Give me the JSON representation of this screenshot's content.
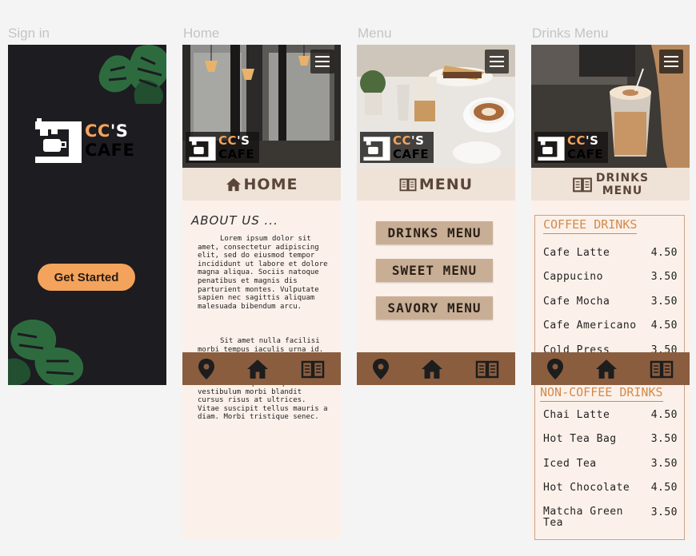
{
  "frames": [
    {
      "label": "Sign in"
    },
    {
      "label": "Home"
    },
    {
      "label": "Menu"
    },
    {
      "label": "Drinks Menu"
    }
  ],
  "logo": {
    "cc": "CC",
    "rest": "'S",
    "cafe": "CAFE"
  },
  "signin": {
    "button": "Get Started"
  },
  "home": {
    "title": "HOME",
    "about_title": "ABOUT US ...",
    "para1": "Lorem ipsum dolor sit amet, consectetur adipiscing elit, sed do eiusmod tempor incididunt ut labore et dolore magna aliqua. Sociis natoque penatibus et magnis dis parturient montes. Vulputate sapien nec sagittis aliquam malesuada bibendum arcu.",
    "para2": "Sit amet nulla facilisi morbi tempus iaculis urna id. Ipsum pretium quam vulputate dignissim suspendisse in est ante. Mauris nunc congue nisi vitae. Id neque aliquam vestibulum morbi blandit cursus risus at ultrices. Vitae suscipit tellus mauris a diam. Morbi tristique senec."
  },
  "menu": {
    "title": "MENU",
    "buttons": [
      "DRINKS MENU",
      "SWEET MENU",
      "SAVORY MENU"
    ]
  },
  "drinks": {
    "title_line1": "DRINKS",
    "title_line2": "MENU",
    "coffee_heading": "COFFEE DRINKS",
    "coffee": [
      {
        "name": "Cafe Latte",
        "price": "4.50"
      },
      {
        "name": "Cappucino",
        "price": "3.50"
      },
      {
        "name": "Cafe Mocha",
        "price": "3.50"
      },
      {
        "name": "Cafe Americano",
        "price": "4.50"
      },
      {
        "name": "Cold Press",
        "price": "3.50"
      }
    ],
    "noncoffee_heading": "NON-COFFEE DRINKS",
    "noncoffee": [
      {
        "name": "Chai Latte",
        "price": "4.50"
      },
      {
        "name": "Hot Tea Bag",
        "price": "3.50"
      },
      {
        "name": "Iced Tea",
        "price": "3.50"
      },
      {
        "name": "Hot Chocolate",
        "price": "4.50"
      },
      {
        "name": "Matcha Green Tea",
        "price": "3.50"
      }
    ]
  },
  "icons": {
    "location": "location-pin-icon",
    "home": "home-icon",
    "menu": "book-icon",
    "hamburger": "hamburger-menu-icon"
  },
  "colors": {
    "accent": "#f3a35b",
    "nav": "#8a5d3f",
    "cream": "#fbf1ea",
    "dark": "#1d1c20"
  }
}
